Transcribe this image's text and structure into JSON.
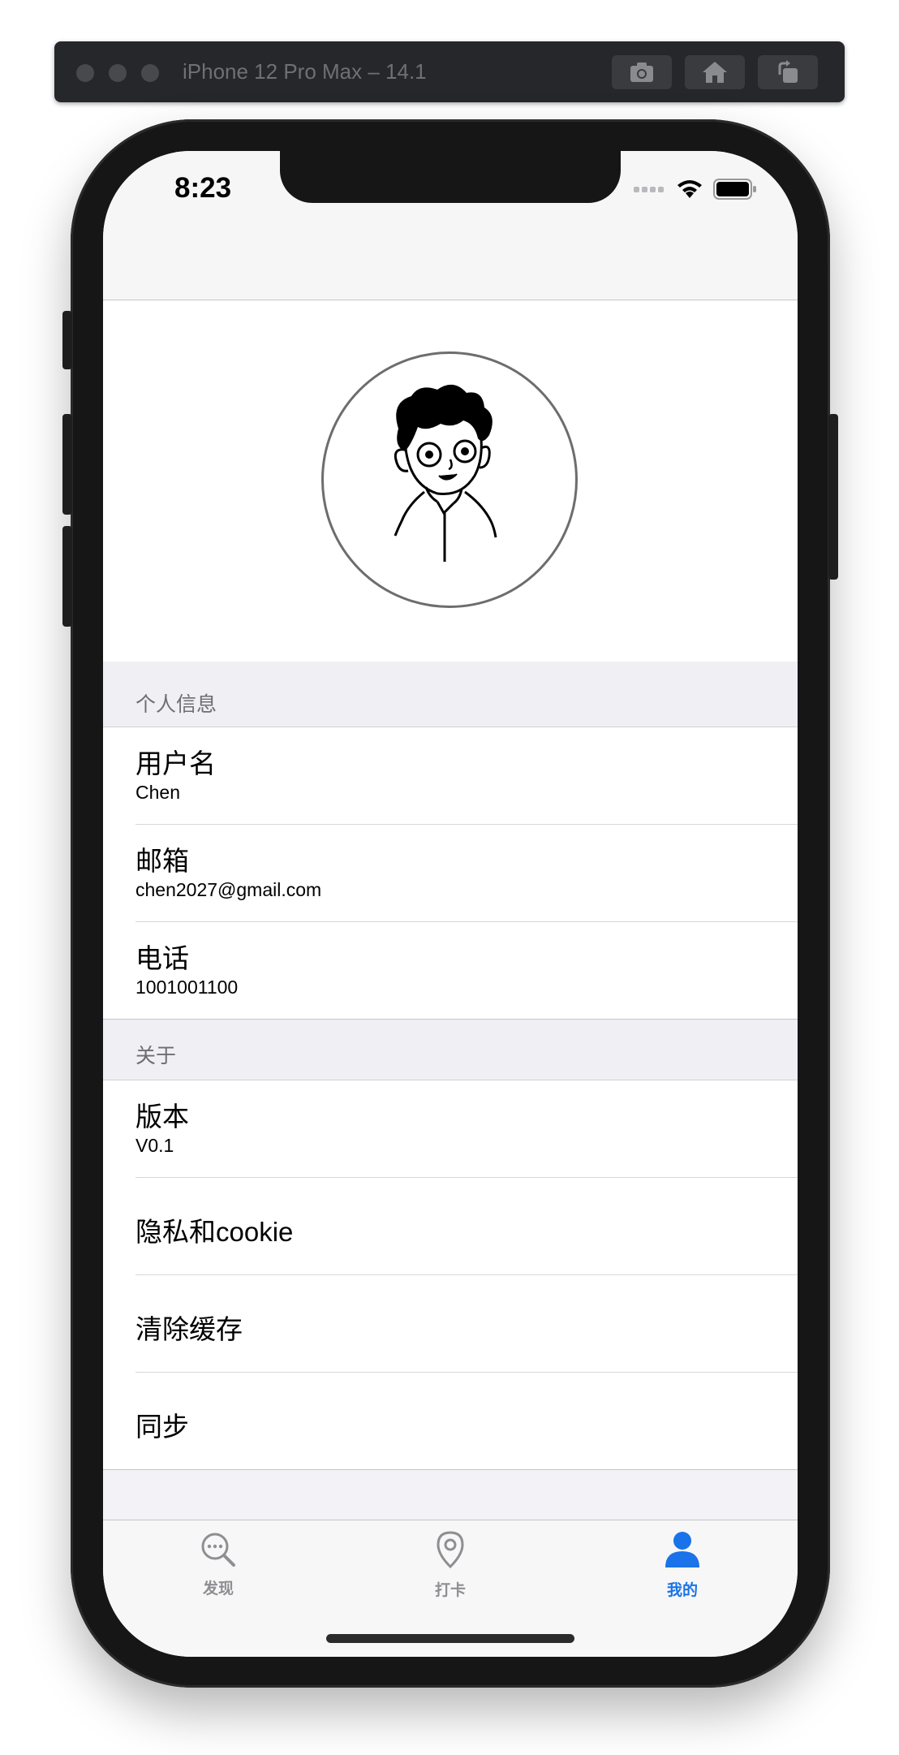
{
  "simulator": {
    "title": "iPhone 12 Pro Max – 14.1"
  },
  "status_bar": {
    "time": "8:23"
  },
  "sections": {
    "personal": {
      "header": "个人信息",
      "rows": [
        {
          "title": "用户名",
          "value": "Chen"
        },
        {
          "title": "邮箱",
          "value": "chen2027@gmail.com"
        },
        {
          "title": "电话",
          "value": "1001001100"
        }
      ]
    },
    "about": {
      "header": "关于",
      "rows": [
        {
          "title": "版本",
          "value": "V0.1"
        },
        {
          "title": "隐私和cookie"
        },
        {
          "title": "清除缓存"
        },
        {
          "title": "同步"
        }
      ]
    }
  },
  "tabbar": {
    "items": [
      {
        "label": "发现",
        "icon": "search-dots-icon"
      },
      {
        "label": "打卡",
        "icon": "location-pin-icon"
      },
      {
        "label": "我的",
        "icon": "person-icon"
      }
    ],
    "active_color": "#1a73e8",
    "inactive_color": "#8e8e93"
  }
}
